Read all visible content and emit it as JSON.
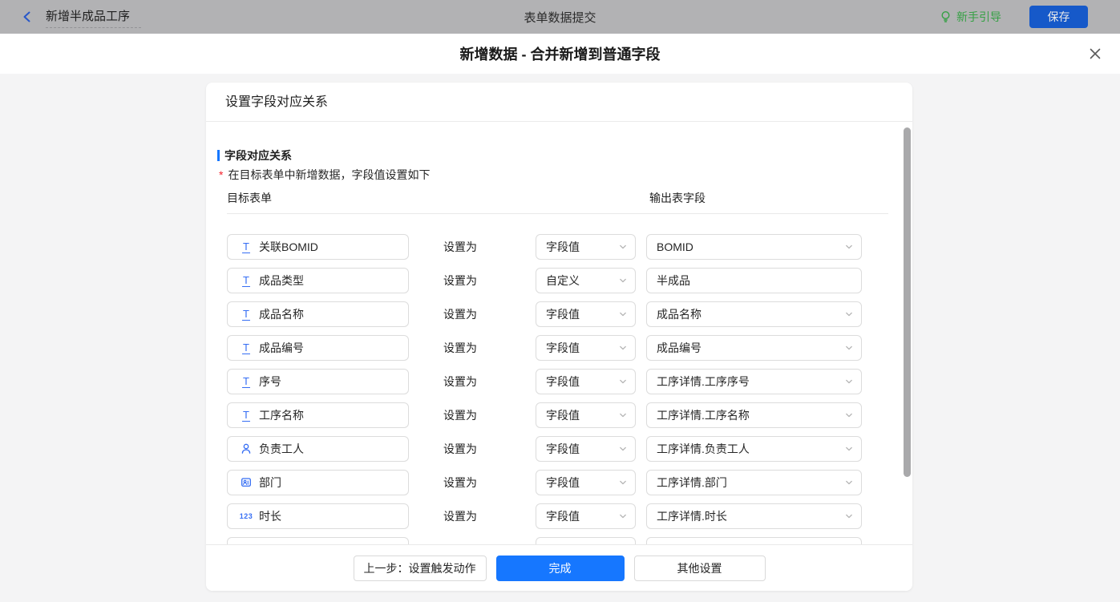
{
  "topbar": {
    "back_label": "新增半成品工序",
    "title": "表单数据提交",
    "guide_label": "新手引导",
    "save_label": "保存"
  },
  "dialog": {
    "title": "新增数据 - 合并新增到普通字段"
  },
  "card": {
    "header": "设置字段对应关系",
    "section_title": "字段对应关系",
    "required_note": "在目标表单中新增数据，字段值设置如下",
    "columns": {
      "left": "目标表单",
      "right": "输出表字段"
    },
    "set_label": "设置为",
    "rows": [
      {
        "icon": "text",
        "field": "关联BOMID",
        "mode": "字段值",
        "output": "BOMID",
        "output_type": "select"
      },
      {
        "icon": "text",
        "field": "成品类型",
        "mode": "自定义",
        "output": "半成品",
        "output_type": "input"
      },
      {
        "icon": "text",
        "field": "成品名称",
        "mode": "字段值",
        "output": "成品名称",
        "output_type": "select"
      },
      {
        "icon": "text",
        "field": "成品编号",
        "mode": "字段值",
        "output": "成品编号",
        "output_type": "select"
      },
      {
        "icon": "text",
        "field": "序号",
        "mode": "字段值",
        "output": "工序详情.工序序号",
        "output_type": "select"
      },
      {
        "icon": "text",
        "field": "工序名称",
        "mode": "字段值",
        "output": "工序详情.工序名称",
        "output_type": "select"
      },
      {
        "icon": "user",
        "field": "负责工人",
        "mode": "字段值",
        "output": "工序详情.负责工人",
        "output_type": "select"
      },
      {
        "icon": "dept",
        "field": "部门",
        "mode": "字段值",
        "output": "工序详情.部门",
        "output_type": "select"
      },
      {
        "icon": "number",
        "field": "时长",
        "mode": "字段值",
        "output": "工序详情.时长",
        "output_type": "select"
      },
      {
        "icon": "",
        "field": "",
        "mode": "",
        "output": "",
        "output_type": "select",
        "partial": true
      }
    ],
    "footer": {
      "prev": "上一步：设置触发动作",
      "done": "完成",
      "other": "其他设置"
    }
  },
  "colors": {
    "primary_blue": "#1677ff",
    "save_button_blue": "#1659c9",
    "guide_green": "#35a044",
    "required_red": "#f5222d",
    "field_icon_blue": "#366ef4",
    "topbar_gray": "#b2b2b4",
    "scrollbar_thumb": "#a9a9ab"
  }
}
